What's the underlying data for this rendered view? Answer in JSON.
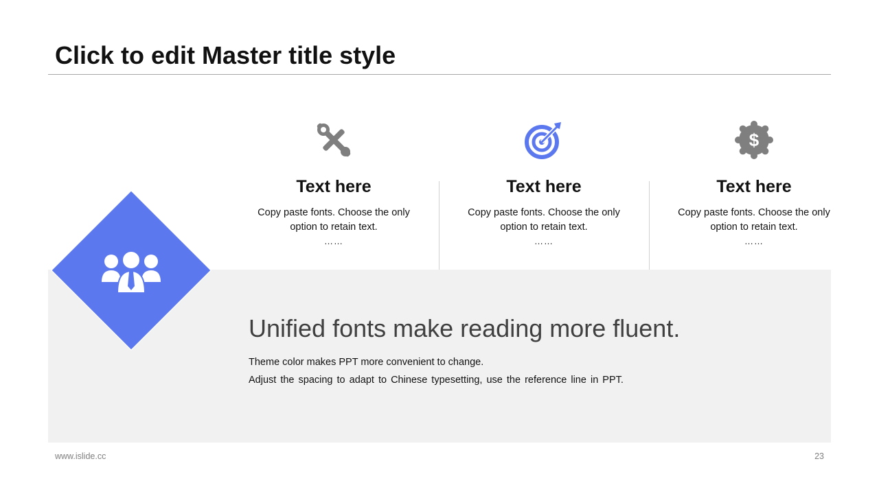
{
  "slide": {
    "title": "Click to edit Master title style",
    "headline": "Unified fonts make reading more fluent.",
    "body_line_1": "Theme color makes PPT more convenient to change.",
    "body_line_2": "Adjust the spacing to adapt to Chinese typesetting, use the reference line in PPT.",
    "center_icon": "team-icon"
  },
  "columns": [
    {
      "icon": "tools-icon",
      "icon_color": "#7f7f7f",
      "title": "Text here",
      "text": "Copy paste fonts. Choose the only option to retain text.",
      "dots": "……"
    },
    {
      "icon": "target-icon",
      "icon_color": "#5b78ef",
      "title": "Text here",
      "text": "Copy paste fonts. Choose the only option to retain text.",
      "dots": "……"
    },
    {
      "icon": "dollar-badge-icon",
      "icon_color": "#7f7f7f",
      "title": "Text here",
      "text": "Copy paste fonts. Choose the only option to retain text.",
      "dots": "……"
    }
  ],
  "footer": {
    "website": "www.islide.cc",
    "page_number": "23"
  },
  "colors": {
    "accent": "#5b78ef",
    "icon_gray": "#7f7f7f",
    "panel_bg": "#f1f1f1"
  }
}
